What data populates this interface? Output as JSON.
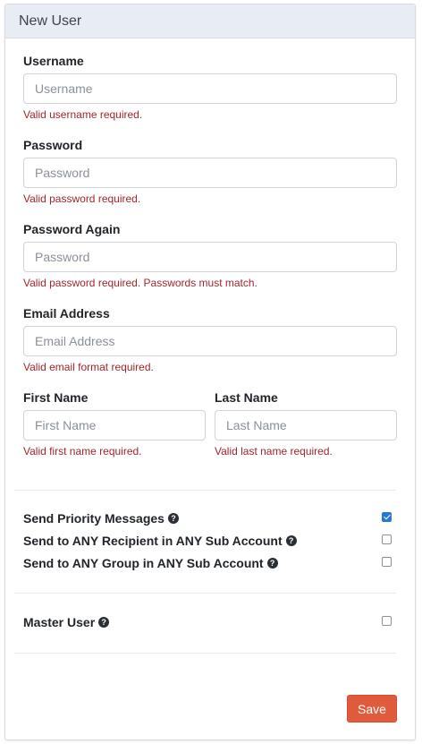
{
  "panel": {
    "title": "New User"
  },
  "form": {
    "username": {
      "label": "Username",
      "placeholder": "Username",
      "error": "Valid username required."
    },
    "password": {
      "label": "Password",
      "placeholder": "Password",
      "error": "Valid password required."
    },
    "password_again": {
      "label": "Password Again",
      "placeholder": "Password",
      "error": "Valid password required. Passwords must match."
    },
    "email": {
      "label": "Email Address",
      "placeholder": "Email Address",
      "error": "Valid email format required."
    },
    "first_name": {
      "label": "First Name",
      "placeholder": "First Name",
      "error": "Valid first name required."
    },
    "last_name": {
      "label": "Last Name",
      "placeholder": "Last Name",
      "error": "Valid last name required."
    }
  },
  "options": [
    {
      "label": "Send Priority Messages",
      "checked": true
    },
    {
      "label": "Send to ANY Recipient in ANY Sub Account",
      "checked": false
    },
    {
      "label": "Send to ANY Group in ANY Sub Account",
      "checked": false
    }
  ],
  "master_user": {
    "label": "Master User",
    "checked": false
  },
  "help_icon": {
    "icon": "question-circle-icon",
    "glyph": "?"
  },
  "actions": {
    "save_label": "Save"
  },
  "colors": {
    "accent": "#e05a3c",
    "error": "#a3262a",
    "checkbox": "#2a78d6",
    "header_bg": "#e8ecf3"
  }
}
